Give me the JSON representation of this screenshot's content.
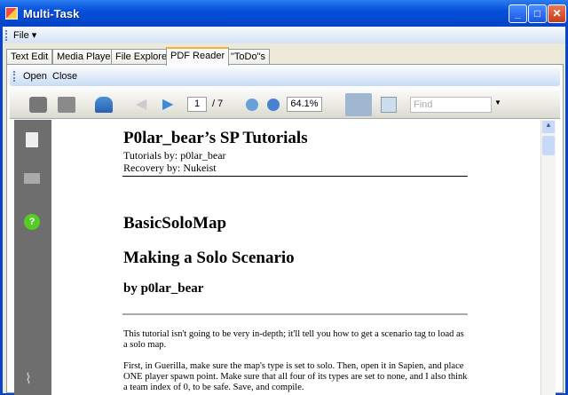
{
  "window": {
    "title": "Multi-Task",
    "min": "_",
    "max": "□",
    "close": "✕"
  },
  "menu": {
    "file": "File ▾"
  },
  "tabs": [
    "Text Edit",
    "Media Player",
    "File Explorer",
    "PDF Reader",
    "\"ToDo\"s"
  ],
  "toolbar": {
    "open": "Open",
    "close": "Close"
  },
  "pdf": {
    "page": "1",
    "total": "/ 7",
    "zoom": "64.1%",
    "find_placeholder": "Find"
  },
  "doc": {
    "title": "P0lar_bear’s SP Tutorials",
    "by": "Tutorials by: p0lar_bear",
    "recovery": "Recovery by: Nukeist",
    "h1": "BasicSoloMap",
    "h2": "Making a Solo Scenario",
    "h3": "by p0lar_bear",
    "p1": "This tutorial isn't going to be very in-depth; it'll tell you how to get a scenario tag to load as a solo map.",
    "p2": "First, in Guerilla, make sure the map's type is set to solo. Then, open it in Sapien, and place ONE player spawn point. Make sure that all four of its types are set to none, and I also think a team index of 0, to be safe. Save, and compile."
  }
}
